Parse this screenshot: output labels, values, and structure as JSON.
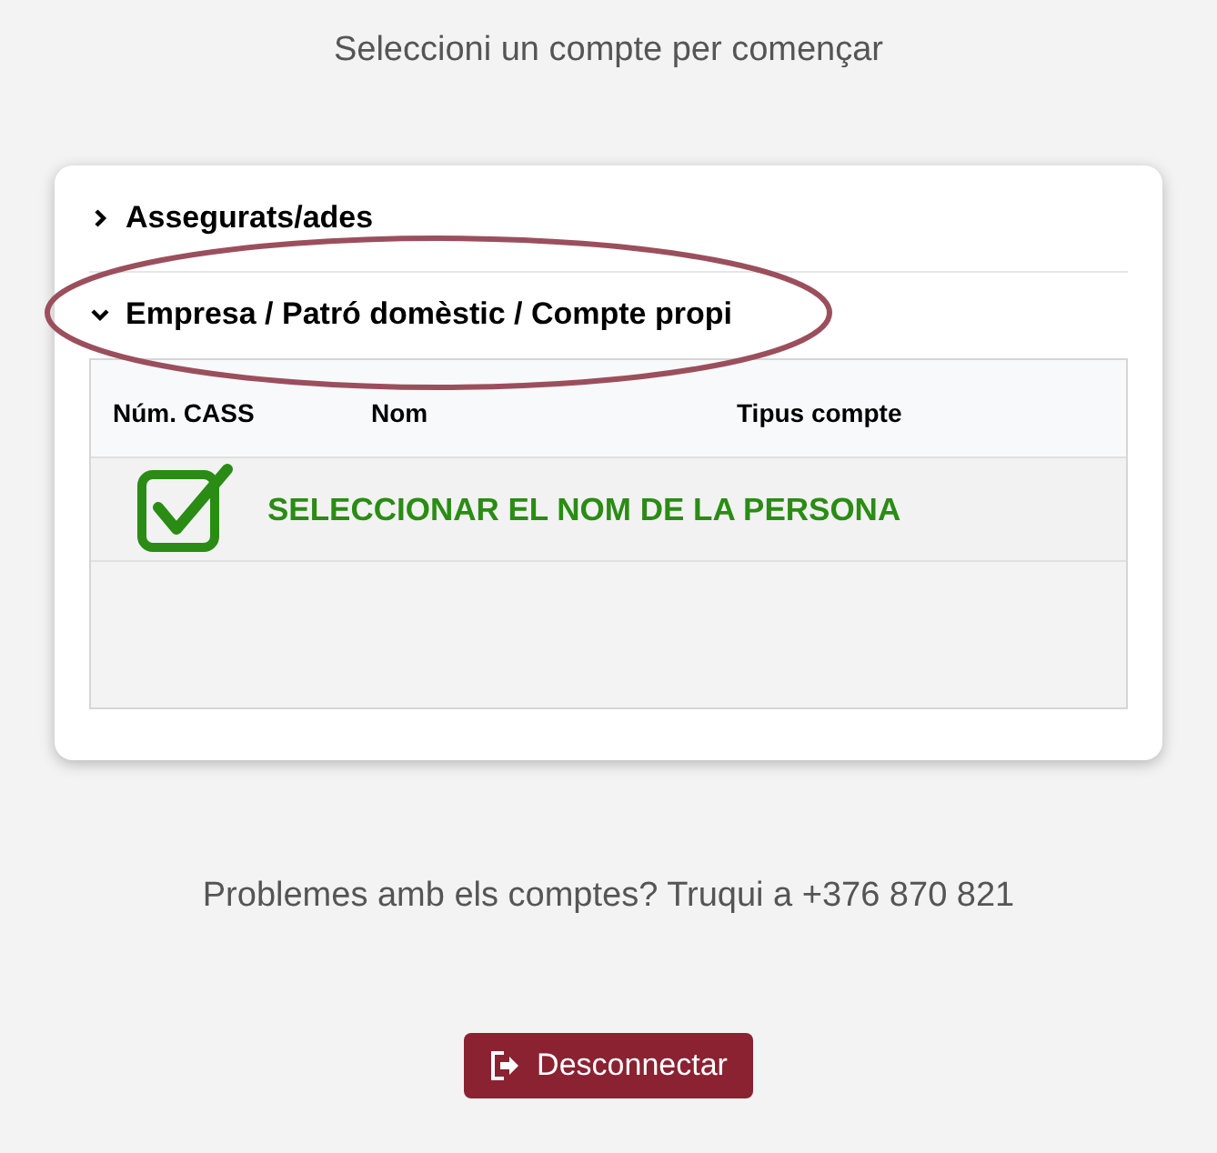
{
  "heading": "Seleccioni un compte per començar",
  "sections": [
    {
      "label": "Assegurats/ades",
      "expanded": false
    },
    {
      "label": "Empresa / Patró domèstic / Compte propi",
      "expanded": true,
      "highlighted": true
    }
  ],
  "table": {
    "columns": [
      "Núm. CASS",
      "Nom",
      "Tipus compte"
    ]
  },
  "annotation": {
    "text": "SELECCIONAR EL NOM DE LA PERSONA",
    "checked": true
  },
  "help_text": "Problemes amb els comptes? Truqui a +376 870 821",
  "logout_button": "Desconnectar"
}
